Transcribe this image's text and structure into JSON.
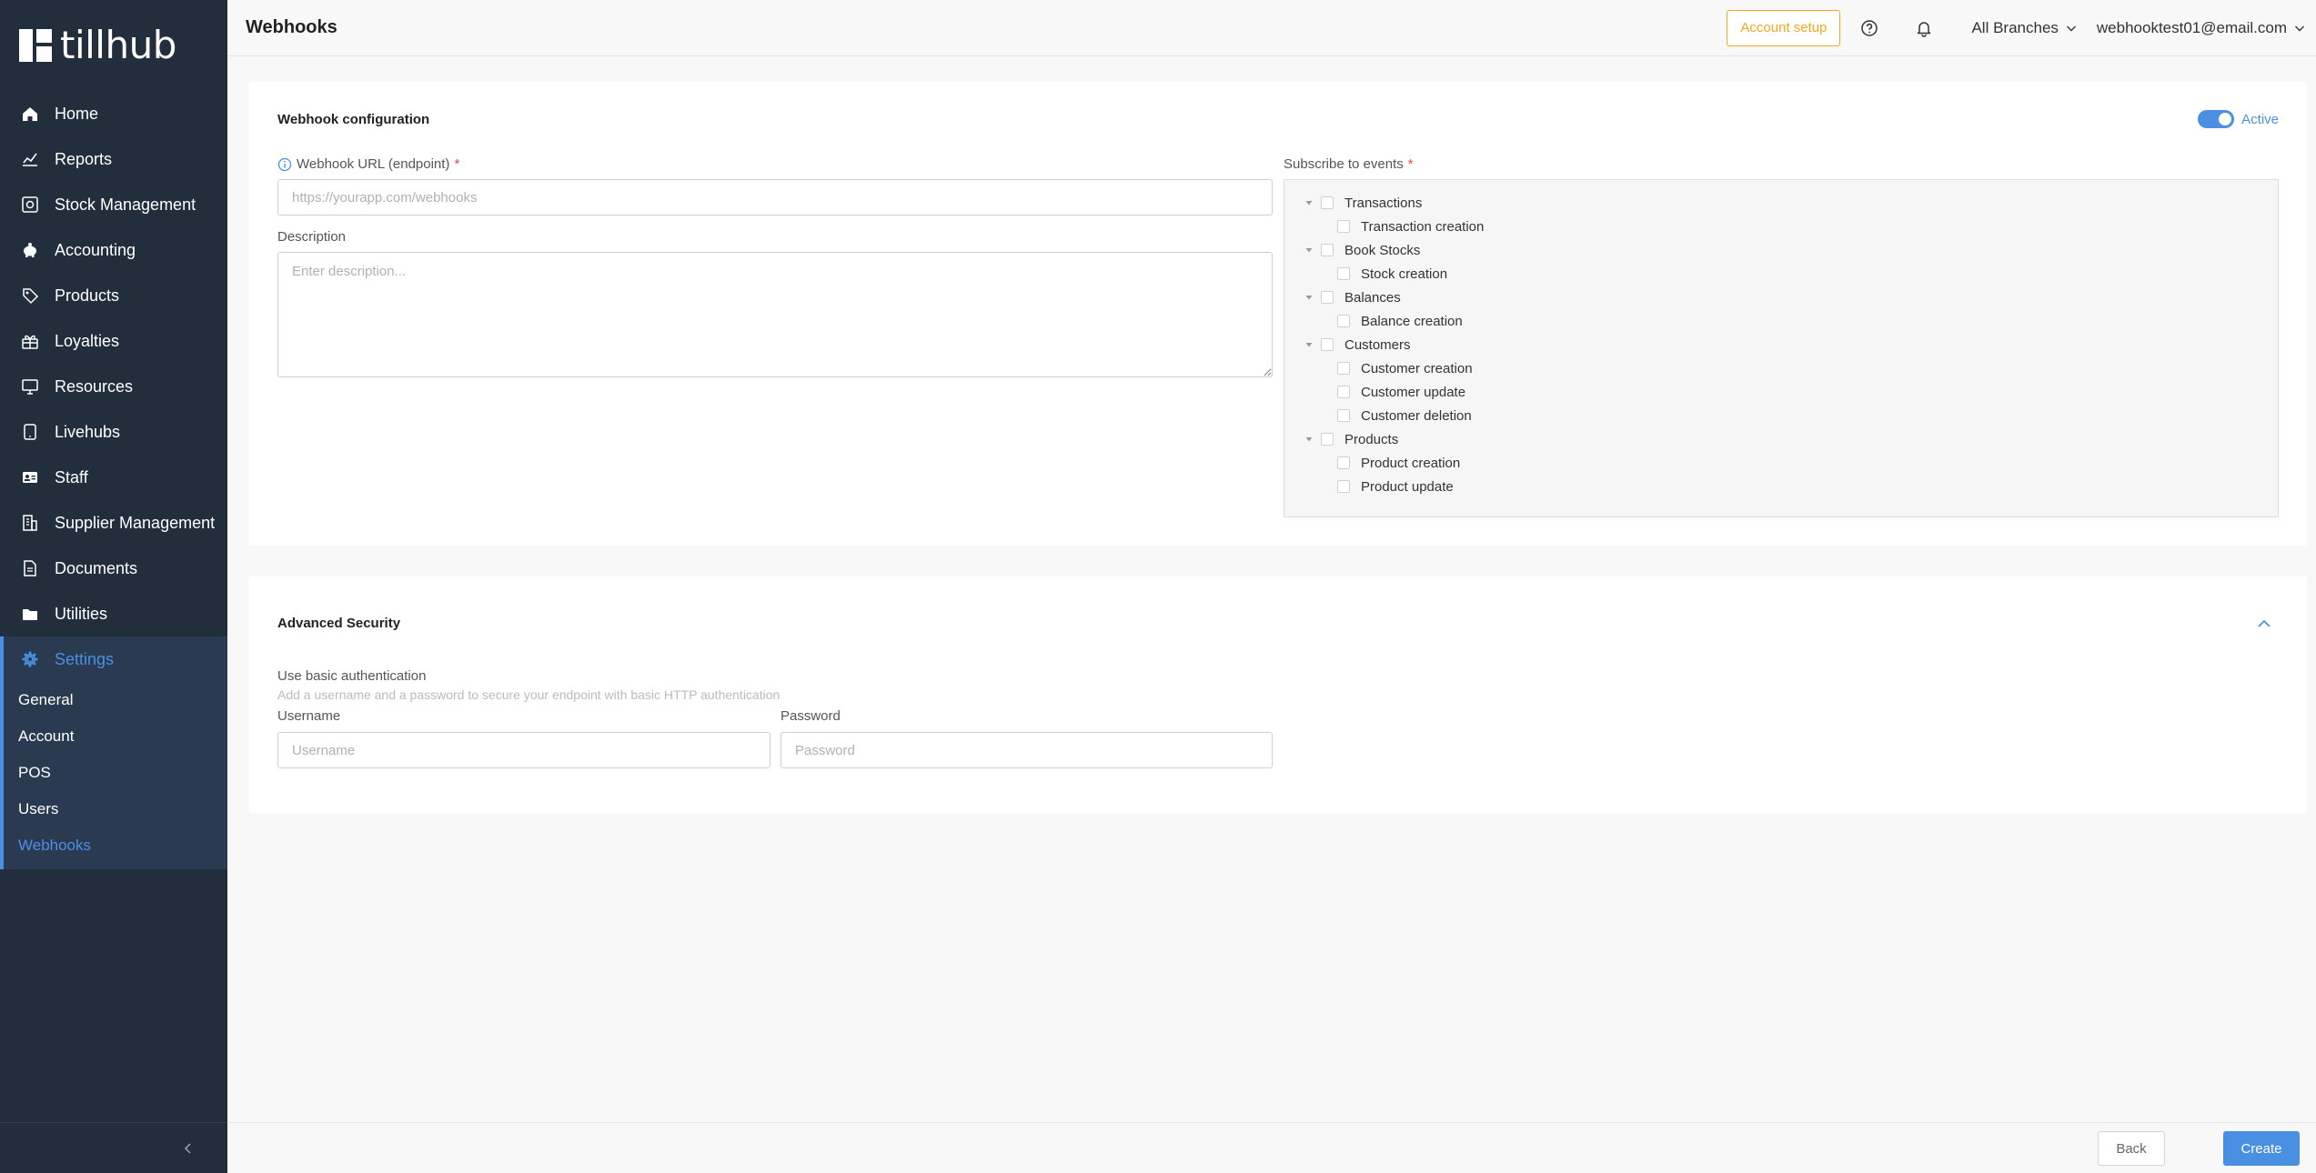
{
  "app": {
    "logo_text": "tillhub"
  },
  "sidebar": {
    "items": [
      {
        "label": "Home",
        "icon": "home-icon"
      },
      {
        "label": "Reports",
        "icon": "chart-icon"
      },
      {
        "label": "Stock Management",
        "icon": "stock-icon"
      },
      {
        "label": "Accounting",
        "icon": "piggy-bank-icon"
      },
      {
        "label": "Products",
        "icon": "tag-icon"
      },
      {
        "label": "Loyalties",
        "icon": "gift-icon"
      },
      {
        "label": "Resources",
        "icon": "monitor-icon"
      },
      {
        "label": "Livehubs",
        "icon": "tablet-icon"
      },
      {
        "label": "Staff",
        "icon": "id-card-icon"
      },
      {
        "label": "Supplier Management",
        "icon": "building-icon"
      },
      {
        "label": "Documents",
        "icon": "document-icon"
      },
      {
        "label": "Utilities",
        "icon": "folder-icon"
      }
    ],
    "settings": {
      "label": "Settings",
      "icon": "gear-icon",
      "children": [
        "General",
        "Account",
        "POS",
        "Users",
        "Webhooks"
      ],
      "active": "Webhooks"
    }
  },
  "header": {
    "title": "Webhooks",
    "account_setup": "Account setup",
    "branch": "All Branches",
    "user": "webhooktest01@email.com"
  },
  "config": {
    "title": "Webhook configuration",
    "active_label": "Active",
    "url_label": "Webhook URL (endpoint)",
    "url_placeholder": "https://yourapp.com/webhooks",
    "url_value": "",
    "description_label": "Description",
    "description_placeholder": "Enter description...",
    "events_label": "Subscribe to events",
    "events": [
      {
        "label": "Transactions",
        "children": [
          "Transaction creation"
        ]
      },
      {
        "label": "Book Stocks",
        "children": [
          "Stock creation"
        ]
      },
      {
        "label": "Balances",
        "children": [
          "Balance creation"
        ]
      },
      {
        "label": "Customers",
        "children": [
          "Customer creation",
          "Customer update",
          "Customer deletion"
        ]
      },
      {
        "label": "Products",
        "children": [
          "Product creation",
          "Product update"
        ]
      }
    ]
  },
  "security": {
    "title": "Advanced Security",
    "basic_auth_label": "Use basic authentication",
    "basic_auth_help": "Add a username and a password to secure your endpoint with basic HTTP authentication",
    "username_label": "Username",
    "username_placeholder": "Username",
    "password_label": "Password",
    "password_placeholder": "Password"
  },
  "footer": {
    "back": "Back",
    "create": "Create"
  },
  "colors": {
    "accent": "#4a90e2",
    "sidebar_bg": "#232e3c",
    "warning": "#f5a623",
    "required": "#e64848"
  }
}
